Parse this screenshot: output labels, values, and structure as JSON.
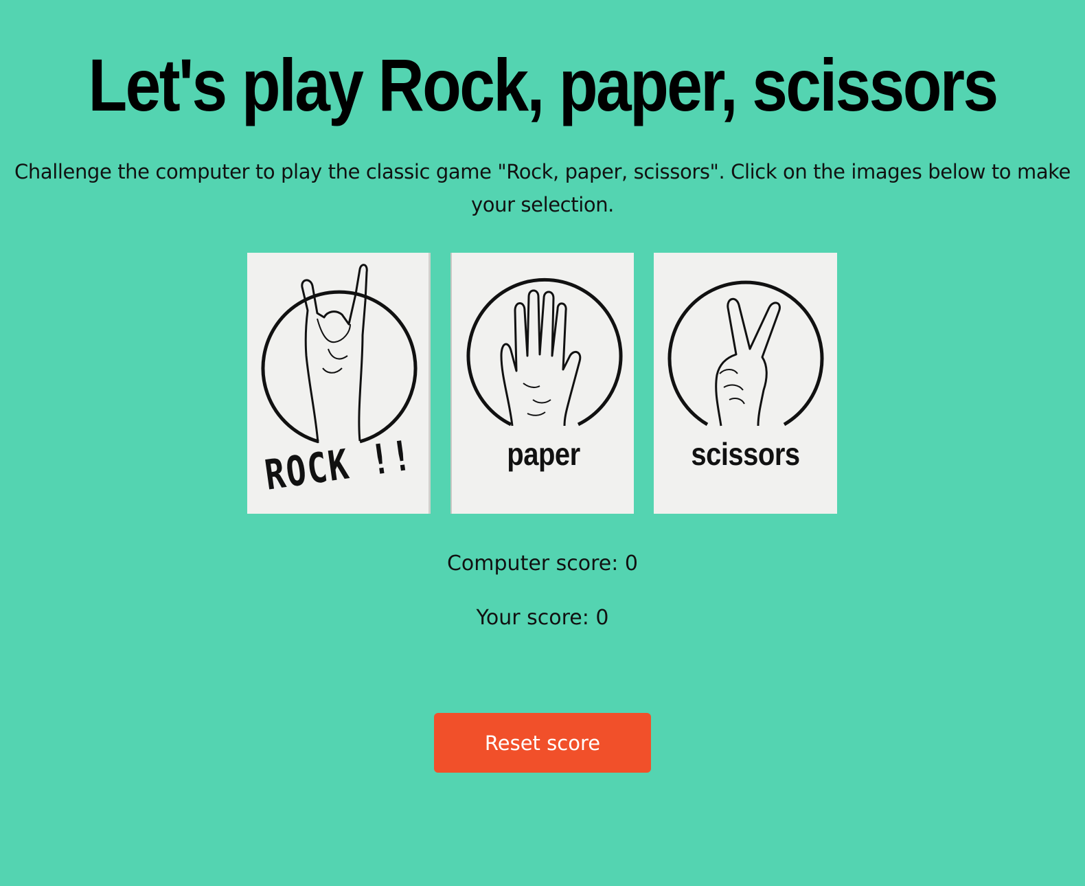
{
  "header": {
    "title": "Let's play Rock, paper, scissors",
    "intro": "Challenge the computer to play the classic game \"Rock, paper, scissors\". Click on the images below to make your selection."
  },
  "choices": [
    {
      "label": "ROCK !!",
      "icon": "rock-hand-icon"
    },
    {
      "label": "paper",
      "icon": "paper-hand-icon"
    },
    {
      "label": "scissors",
      "icon": "scissors-hand-icon"
    }
  ],
  "scores": {
    "computer_label": "Computer score:",
    "computer_value": "0",
    "player_label": "Your score:",
    "player_value": "0"
  },
  "reset_button": {
    "label": "Reset score"
  },
  "colors": {
    "background": "#54d4b1",
    "button": "#f1502a",
    "card": "#f1f1ef"
  }
}
